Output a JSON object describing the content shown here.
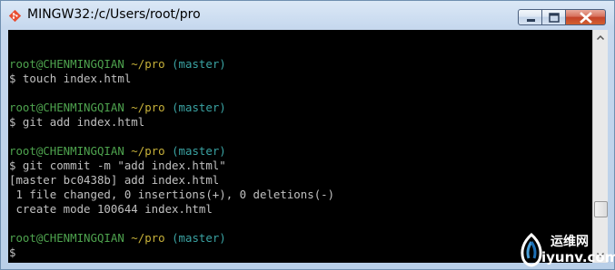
{
  "window": {
    "title": "MINGW32:/c/Users/root/pro"
  },
  "terminal": {
    "lines": [
      [],
      [
        {
          "text": "root@CHENMINGQIAN",
          "color": "green"
        },
        {
          "text": " "
        },
        {
          "text": "~/pro",
          "color": "yellow"
        },
        {
          "text": " (master)",
          "color": "cyan"
        }
      ],
      [
        {
          "text": "$ touch index.html"
        }
      ],
      [],
      [
        {
          "text": "root@CHENMINGQIAN",
          "color": "green"
        },
        {
          "text": " "
        },
        {
          "text": "~/pro",
          "color": "yellow"
        },
        {
          "text": " (master)",
          "color": "cyan"
        }
      ],
      [
        {
          "text": "$ git add index.html"
        }
      ],
      [],
      [
        {
          "text": "root@CHENMINGQIAN",
          "color": "green"
        },
        {
          "text": " "
        },
        {
          "text": "~/pro",
          "color": "yellow"
        },
        {
          "text": " (master)",
          "color": "cyan"
        }
      ],
      [
        {
          "text": "$ git commit -m \"add index.html\""
        }
      ],
      [
        {
          "text": "[master bc0438b] add index.html"
        }
      ],
      [
        {
          "text": " 1 file changed, 0 insertions(+), 0 deletions(-)"
        }
      ],
      [
        {
          "text": " create mode 100644 index.html"
        }
      ],
      [],
      [
        {
          "text": "root@CHENMINGQIAN",
          "color": "green"
        },
        {
          "text": " "
        },
        {
          "text": "~/pro",
          "color": "yellow"
        },
        {
          "text": " (master)",
          "color": "cyan"
        }
      ],
      [
        {
          "text": "$"
        }
      ]
    ]
  },
  "scrollbar": {
    "position_fraction": 0.84
  },
  "watermark": {
    "line1": "运维网",
    "line2": "iyunv.com"
  },
  "icons": {
    "app": "git-icon",
    "minimize": "minimize-icon",
    "maximize": "maximize-icon",
    "close": "close-icon"
  },
  "colors": {
    "prompt_user": "#4ea34e",
    "prompt_path": "#c8b23a",
    "prompt_branch": "#3aa3a3",
    "text": "#c0c0c0",
    "background": "#000000"
  }
}
